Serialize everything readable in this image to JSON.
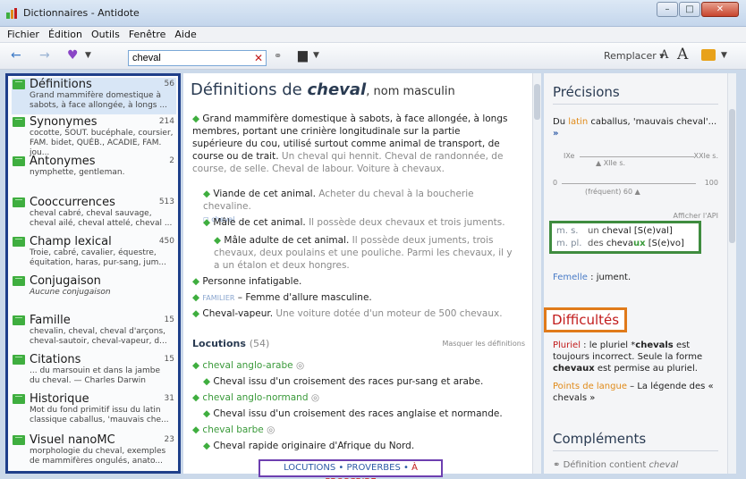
{
  "window": {
    "title": "Dictionnaires - Antidote"
  },
  "menu": [
    "Fichier",
    "Édition",
    "Outils",
    "Fenêtre",
    "Aide"
  ],
  "toolbar": {
    "search_value": "cheval",
    "replace_label": "Remplacer"
  },
  "left_panel": [
    {
      "label": "Définitions",
      "count": "56",
      "desc": "Grand mammifère domestique à\nsabots, à face allongée, à longs ...",
      "italic": false
    },
    {
      "label": "Synonymes",
      "count": "214",
      "desc": "cocotte, SOUT. bucéphale, coursier,\nFAM. bidet, QUÉB., ACADIE, FAM. jou...",
      "italic": false
    },
    {
      "label": "Antonymes",
      "count": "2",
      "desc": "nymphette, gentleman.",
      "italic": false
    },
    {
      "label": "Cooccurrences",
      "count": "513",
      "desc": "cheval cabré, cheval sauvage,\ncheval ailé, cheval attelé, cheval ...",
      "italic": false
    },
    {
      "label": "Champ lexical",
      "count": "450",
      "desc": "Troie, cabré, cavalier, équestre,\néquitation, haras, pur-sang, jum...",
      "italic": false
    },
    {
      "label": "Conjugaison",
      "count": "",
      "desc": "Aucune conjugaison",
      "italic": true
    },
    {
      "label": "Famille",
      "count": "15",
      "desc": "chevalin, cheval, cheval d'arçons,\ncheval-sautoir, cheval-vapeur, d...",
      "italic": false
    },
    {
      "label": "Citations",
      "count": "15",
      "desc": "... du marsouin et dans la jambe\ndu cheval.     — Charles Darwin",
      "italic": false
    },
    {
      "label": "Historique",
      "count": "31",
      "desc": "Mot du fond primitif issu du latin\nclassique caballus, 'mauvais che...",
      "italic": false
    },
    {
      "label": "Visuel nanoMC",
      "count": "23",
      "desc": "morphologie du cheval, exemples\nde mammifères ongulés, anato...",
      "italic": false
    }
  ],
  "center": {
    "title_prefix": "Définitions de ",
    "title_word": "cheval",
    "title_suffix": ", nom masculin",
    "def1": "Grand mammifère domestique à sabots, à face allongée, à longs membres, portant une crinière longitudinale sur la partie supérieure du cou, utilisé surtout comme animal de transport, de course ou de trait.",
    "def1_ex": "Un cheval qui hennit. Cheval de randonnée, de course, de selle. Cheval de labour. Voiture à chevaux.",
    "sub1": "Viande de cet animal.",
    "sub1_ex": "Acheter du cheval à la boucherie chevaline.",
    "sub1_tag": "cheval",
    "sub2": "Mâle de cet animal.",
    "sub2_ex": "Il possède deux chevaux et trois juments.",
    "sub3": "Mâle adulte de cet animal.",
    "sub3_ex": "Il possède deux juments, trois chevaux, deux poulains et une pouliche. Parmi les chevaux, il y a un étalon et deux hongres.",
    "def2": "Personne infatigable.",
    "def3_tag": "FAMILIER",
    "def3": " – Femme d'allure masculine.",
    "def4": "Cheval-vapeur.",
    "def4_ex": "Une voiture dotée d'un moteur de 500 chevaux.",
    "locutions_h": "Locutions",
    "locutions_count": "(54)",
    "masquer": "Masquer les définitions",
    "loc1": "cheval anglo-arabe",
    "loc1_def": "Cheval issu d'un croisement des races pur-sang et arabe.",
    "loc2": "cheval anglo-normand",
    "loc2_def": "Cheval issu d'un croisement des races anglaise et normande.",
    "loc3": "cheval barbe",
    "loc3_def": "Cheval rapide originaire d'Afrique du Nord.",
    "footer_l1": "LOCUTIONS • PROVERBES • ",
    "footer_l2": "À PROSCRIRE"
  },
  "right": {
    "precisions_h": "Précisions",
    "etym_a": "Du ",
    "etym_latin": "latin",
    "etym_b": " caballus, 'mauvais cheval'... ",
    "etym_more": "»",
    "tl_left": "IXe",
    "tl_right": "XXIe s.",
    "tl_mid": "XIIe s.",
    "tl_zero": "0",
    "tl_hundred": "100",
    "tl_freq": "(fréquent) 60",
    "afficher": "Afficher l'API",
    "ms_label": "m. s.",
    "ms_art": "un",
    "ms_word": "cheval [S(e)val]",
    "mpl_label": "m. pl.",
    "mpl_art": "des",
    "mpl_word_a": "cheva",
    "mpl_word_b": "ux",
    "mpl_word_c": " [S(e)vo]",
    "feminine_label": "Femelle",
    "feminine": " : jument.",
    "difficultes_h": "Difficultés",
    "pluriel_label": "Pluriel",
    "pluriel_text": " : le pluriel *",
    "pluriel_bad": "chevals",
    "pluriel_text2": " est toujours incorrect. Seule la forme ",
    "pluriel_good": "chevaux",
    "pluriel_text3": " est permise au pluriel.",
    "points_label": "Points de langue",
    "points_text": " – La légende des « chevals »",
    "complements_h": "Compléments",
    "def_contient": "Définition contient ",
    "def_contient_w": "cheval"
  }
}
